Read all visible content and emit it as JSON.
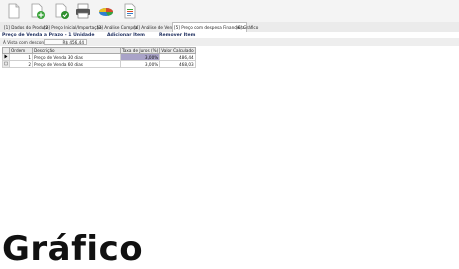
{
  "toolbar": {
    "buttons": [
      "new-icon",
      "add-icon",
      "save-icon",
      "print-icon",
      "chart-pie-icon",
      "report-icon"
    ]
  },
  "tabs": [
    {
      "label": "[1] Dados do Produto",
      "active": false
    },
    {
      "label": "[2] Preço Inicial/Importação",
      "active": false
    },
    {
      "label": "[3] Análise Compra",
      "active": false
    },
    {
      "label": "[4] Análise de Venda",
      "active": false
    },
    {
      "label": "[5] Preço com despesa Financeira",
      "active": true
    },
    {
      "label": "[6] Gráfico",
      "active": false
    }
  ],
  "section": {
    "title": "Preço de Venda a Prazo - 1 Unidade",
    "add_item": "Adicionar Item",
    "remove_item": "Remover Item"
  },
  "discount": {
    "label": "À Vista com desconto:",
    "value": "R$ 456,44"
  },
  "grid": {
    "columns": [
      "Ordem",
      "Descrição",
      "Taxa de Juros (%)",
      "Valor Calculado"
    ],
    "rows": [
      {
        "ordem": "1",
        "descricao": "Preço de Venda 30 dias",
        "taxa": "3,00%",
        "valor": "486,44",
        "selected": true
      },
      {
        "ordem": "2",
        "descricao": "Preço de Venda 60 dias",
        "taxa": "3,00%",
        "valor": "468,03",
        "selected": false
      }
    ]
  },
  "footer": {
    "heading": "Gráfico"
  },
  "colors": {
    "toolbar_bg": "#f4f4f4",
    "selected_cell": "#a9a3c8",
    "title_text": "#1f2f5f"
  }
}
